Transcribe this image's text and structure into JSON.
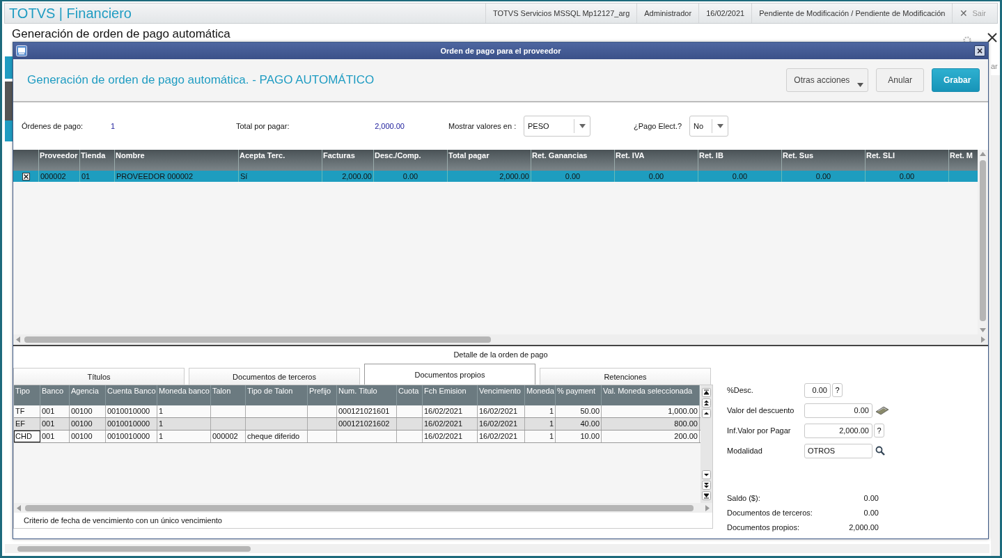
{
  "app_header": {
    "brand": "TOTVS | Financiero",
    "items": [
      "TOTVS Servicios MSSQL Mp12127_arg",
      "Administrador",
      "16/02/2021",
      "Pendiente de Modificación / Pendiente de Modificación"
    ],
    "exit_icon": "✕",
    "exit_label": "Sair"
  },
  "page": {
    "title": "Generación de orden de pago automática",
    "side_text": "ar"
  },
  "dialog": {
    "title": "Orden de pago para el proveedor",
    "close_label": "×",
    "heading": "Generación de orden de pago automática. - PAGO AUTOMÁTICO",
    "buttons": [
      {
        "label": "Otras acciones",
        "kind": "menu"
      },
      {
        "label": "Anular",
        "kind": "plain"
      },
      {
        "label": "Grabar",
        "kind": "primary"
      }
    ],
    "summary": {
      "orders_label": "Órdenes de pago:",
      "orders_value": "1",
      "total_label": "Total por pagar:",
      "total_value": "2,000.00",
      "currency_label": "Mostrar valores en :",
      "currency_value": "PESO",
      "electronic_label": "¿Pago Elect.?",
      "electronic_value": "No"
    },
    "suppliers_table": {
      "columns": [
        "Proveedor",
        "Tienda",
        "Nombre",
        "Acepta Terc.",
        "Facturas",
        "Desc./Comp.",
        "Total pagar",
        "Ret. Ganancias",
        "Ret. IVA",
        "Ret. IB",
        "Ret. Sus",
        "Ret. SLI",
        "Ret. M"
      ],
      "rows": [
        {
          "checked": true,
          "selected": true,
          "cells": [
            "000002",
            "01",
            "PROVEEDOR 000002",
            "Sí",
            "2,000.00",
            "0.00",
            "2,000.00",
            "0.00",
            "0.00",
            "0.00",
            "0.00",
            "0.00",
            ""
          ]
        }
      ]
    },
    "detail_title": "Detalle de la orden de pago",
    "tabs": [
      {
        "label": "Títulos",
        "selected": false
      },
      {
        "label": "Documentos de terceros",
        "selected": false
      },
      {
        "label": "Documentos propios",
        "selected": true
      },
      {
        "label": "Retenciones",
        "selected": false
      }
    ],
    "documents_table": {
      "columns": [
        "Tipo",
        "Banco",
        "Agencia",
        "Cuenta Banco",
        "Moneda banco",
        "Talon",
        "Tipo de Talon",
        "Prefijo",
        "Num. Titulo",
        "Cuota",
        "Fch Emision",
        "Vencimiento",
        "Moneda",
        "% payment",
        "Val. Moneda seleccionada"
      ],
      "rows": [
        {
          "focused": false,
          "cells": [
            "TF",
            "001",
            "00100",
            "0010010000",
            "1",
            "",
            "",
            "",
            "000121021601",
            "",
            "16/02/2021",
            "16/02/2021",
            "1",
            "50.00",
            "1,000.00"
          ]
        },
        {
          "focused": false,
          "cells": [
            "EF",
            "001",
            "00100",
            "0010010000",
            "1",
            "",
            "",
            "",
            "000121021602",
            "",
            "16/02/2021",
            "16/02/2021",
            "1",
            "40.00",
            "800.00"
          ]
        },
        {
          "focused": true,
          "cells": [
            "CHD",
            "001",
            "00100",
            "0010010000",
            "1",
            "000002",
            "cheque diferido",
            "",
            "",
            "",
            "16/02/2021",
            "16/02/2021",
            "1",
            "10.00",
            "200.00"
          ]
        }
      ]
    },
    "date_criteria_legend": "Criterio de fecha de vencimiento con un único vencimiento",
    "fields": [
      {
        "label": "%Desc.",
        "value": "0.00",
        "kind": "help",
        "button_label": "?"
      },
      {
        "label": "Valor del descuento",
        "value": "0.00",
        "kind": "money"
      },
      {
        "label": "Inf.Valor por Pagar",
        "value": "2,000.00",
        "kind": "help",
        "button_label": "?"
      },
      {
        "label": "Modalidad",
        "value": "OTROS",
        "kind": "search"
      }
    ],
    "totals": [
      {
        "label": "Saldo ($):",
        "value": "0.00"
      },
      {
        "label": "Documentos de terceros:",
        "value": "0.00"
      },
      {
        "label": "Documentos propios:",
        "value": "2,000.00"
      }
    ]
  }
}
